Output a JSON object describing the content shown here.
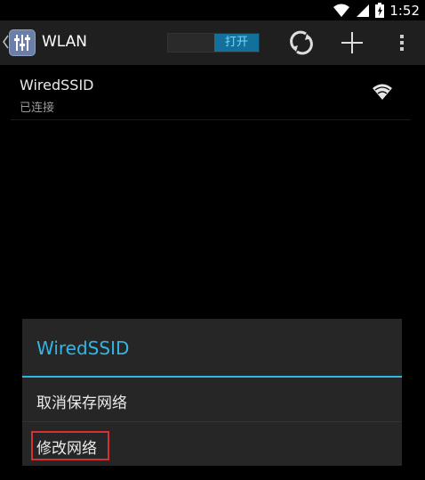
{
  "status_bar": {
    "time": "1:52",
    "icons": [
      "wifi-icon",
      "signal-icon",
      "battery-icon"
    ]
  },
  "action_bar": {
    "title": "WLAN",
    "switch_label": "打开",
    "actions": [
      "refresh-icon",
      "add-icon",
      "overflow-menu-icon"
    ]
  },
  "network_list": [
    {
      "ssid": "WiredSSID",
      "status": "已连接"
    }
  ],
  "dialog": {
    "title": "WiredSSID",
    "items": [
      {
        "label": "取消保存网络"
      },
      {
        "label": "修改网络"
      }
    ]
  },
  "colors": {
    "accent": "#33b5e5",
    "switch_on": "#12709a",
    "highlight": "#d9302f"
  }
}
